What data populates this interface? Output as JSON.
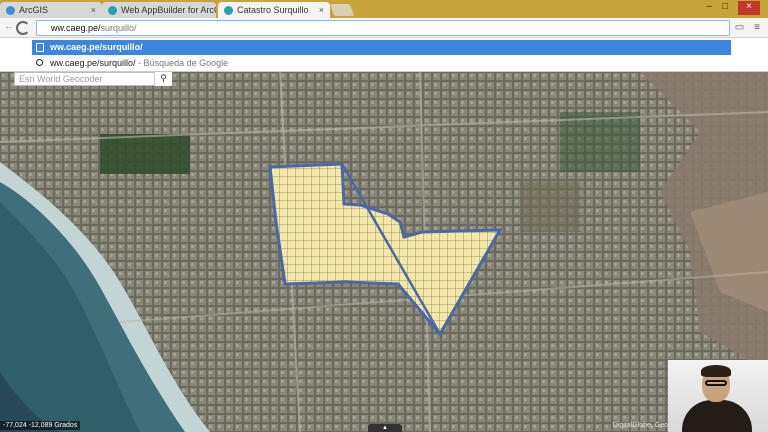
{
  "tabs": [
    {
      "label": "ArcGIS",
      "close": "×"
    },
    {
      "label": "Web AppBuilder for ArcG",
      "close": "×"
    },
    {
      "label": "Catastro Surquillo",
      "close": "×"
    }
  ],
  "window_controls": {
    "min": "–",
    "max": "□",
    "close": "×"
  },
  "omnibox": {
    "typed": "ww.caeg.pe/",
    "completion": "surquillo/"
  },
  "suggestions": [
    {
      "text": "ww.caeg.pe/surquillo/",
      "hint": ""
    },
    {
      "text": "ww.caeg.pe/surquillo/",
      "hint": " - Búsqueda de Google"
    }
  ],
  "map": {
    "geocoder_placeholder": "Esri World Geocoder",
    "search_icon": "search-icon",
    "coordinates": "-77,024 -12,089 Grados",
    "attribution": "DigitalGlobe, Geo",
    "colors": {
      "parcel_fill": "#f2e7a6",
      "boundary": "#4a68a8",
      "ocean": "#3f6f7a",
      "surf": "#d9e6e4"
    }
  }
}
